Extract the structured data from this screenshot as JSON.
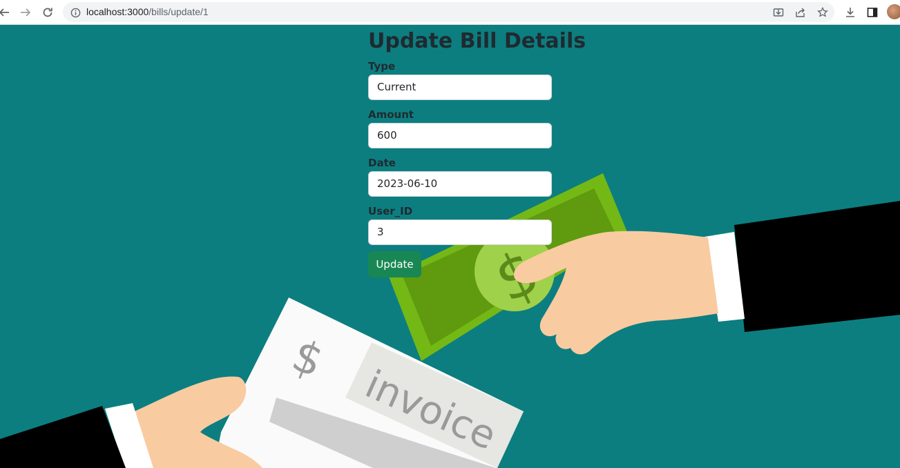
{
  "browser": {
    "url_host": "localhost:3000",
    "url_path": "/bills/update/1",
    "icons": [
      "back-icon",
      "forward-icon",
      "reload-icon",
      "site-info-icon",
      "install-icon",
      "share-icon",
      "bookmark-star-icon",
      "downloads-icon",
      "side-panel-icon",
      "profile-avatar"
    ]
  },
  "form": {
    "title": "Update Bill Details",
    "fields": [
      {
        "label": "Type",
        "value": "Current"
      },
      {
        "label": "Amount",
        "value": "600"
      },
      {
        "label": "Date",
        "value": "2023-06-10"
      },
      {
        "label": "User_ID",
        "value": "3"
      }
    ],
    "submit_label": "Update"
  },
  "illustration": {
    "invoice_symbol": "$",
    "invoice_text": "invoice",
    "banknote_symbol": "$"
  },
  "colors": {
    "background": "#0c7e80",
    "button": "#198754",
    "banknote": "#6aa80e"
  }
}
